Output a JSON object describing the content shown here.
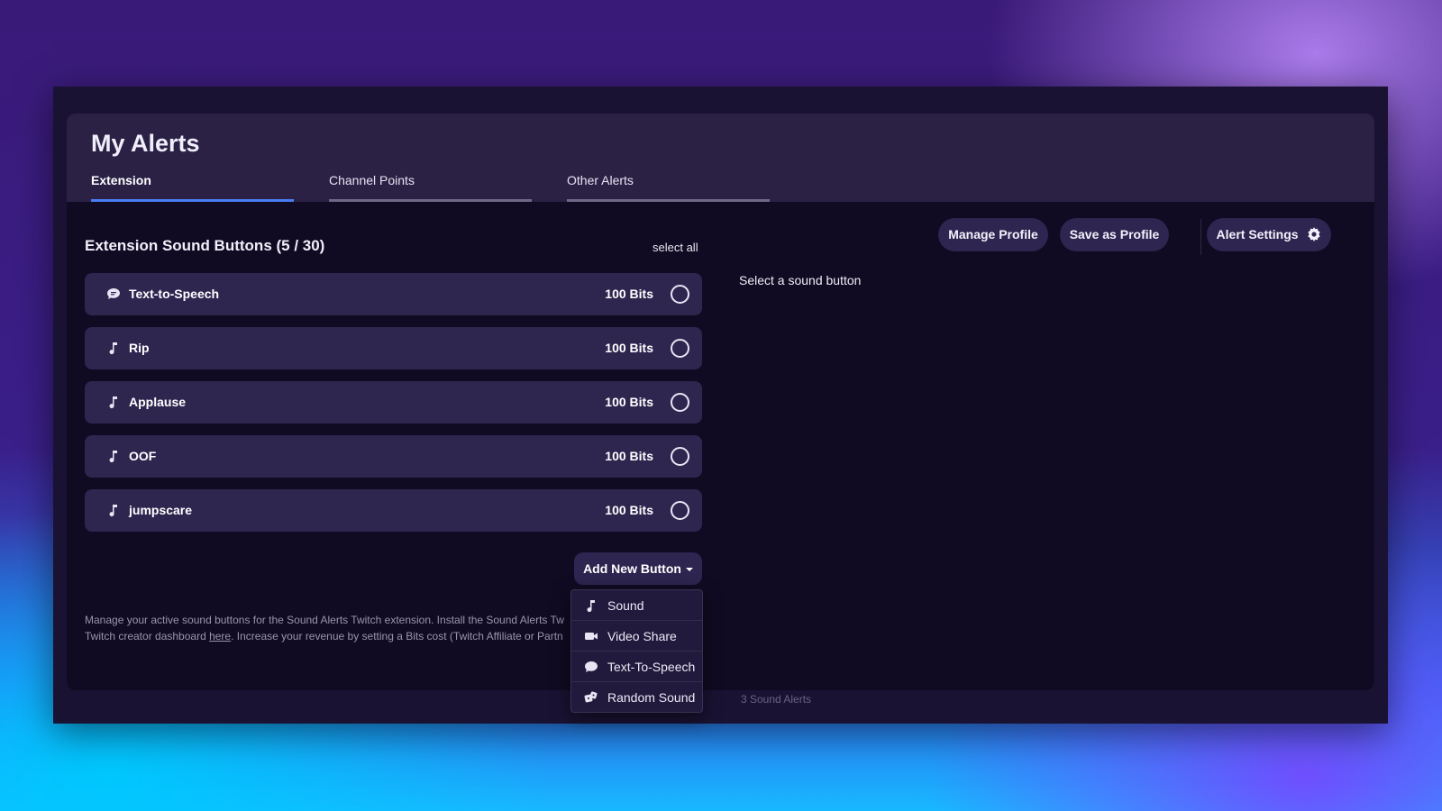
{
  "page": {
    "title": "My Alerts",
    "tabs": [
      {
        "label": "Extension",
        "active": true
      },
      {
        "label": "Channel Points",
        "active": false
      },
      {
        "label": "Other Alerts",
        "active": false
      }
    ]
  },
  "sound_buttons": {
    "title": "Extension Sound Buttons (5 / 30)",
    "select_all": "select all",
    "items": [
      {
        "name": "Text-to-Speech",
        "cost": "100 Bits",
        "icon": "chat-icon"
      },
      {
        "name": "Rip",
        "cost": "100 Bits",
        "icon": "music-note-icon"
      },
      {
        "name": "Applause",
        "cost": "100 Bits",
        "icon": "music-note-icon"
      },
      {
        "name": "OOF",
        "cost": "100 Bits",
        "icon": "music-note-icon"
      },
      {
        "name": "jumpscare",
        "cost": "100 Bits",
        "icon": "music-note-icon"
      }
    ],
    "add_button": "Add New Button"
  },
  "toolbar": {
    "manage_profile": "Manage Profile",
    "save_as_profile": "Save as Profile",
    "alert_settings": "Alert Settings"
  },
  "detail": {
    "hint": "Select a sound button"
  },
  "help": {
    "line1": "Manage your active sound buttons for the Sound Alerts Twitch extension. Install the Sound Alerts Tw",
    "line2_pre": "Twitch creator dashboard ",
    "line2_link": "here",
    "line2_post": ". Increase your revenue by setting a Bits cost (Twitch Affiliate or Partn"
  },
  "footer": "3 Sound Alerts",
  "dropdown": {
    "items": [
      {
        "label": "Sound",
        "icon": "music-note-icon"
      },
      {
        "label": "Video Share",
        "icon": "video-camera-icon"
      },
      {
        "label": "Text-To-Speech",
        "icon": "chat-icon"
      },
      {
        "label": "Random Sound",
        "icon": "dice-icon"
      }
    ]
  },
  "colors": {
    "active_tab": "#4a7cf3",
    "row_bg": "#2f2650",
    "panel_bg": "#100b22"
  }
}
